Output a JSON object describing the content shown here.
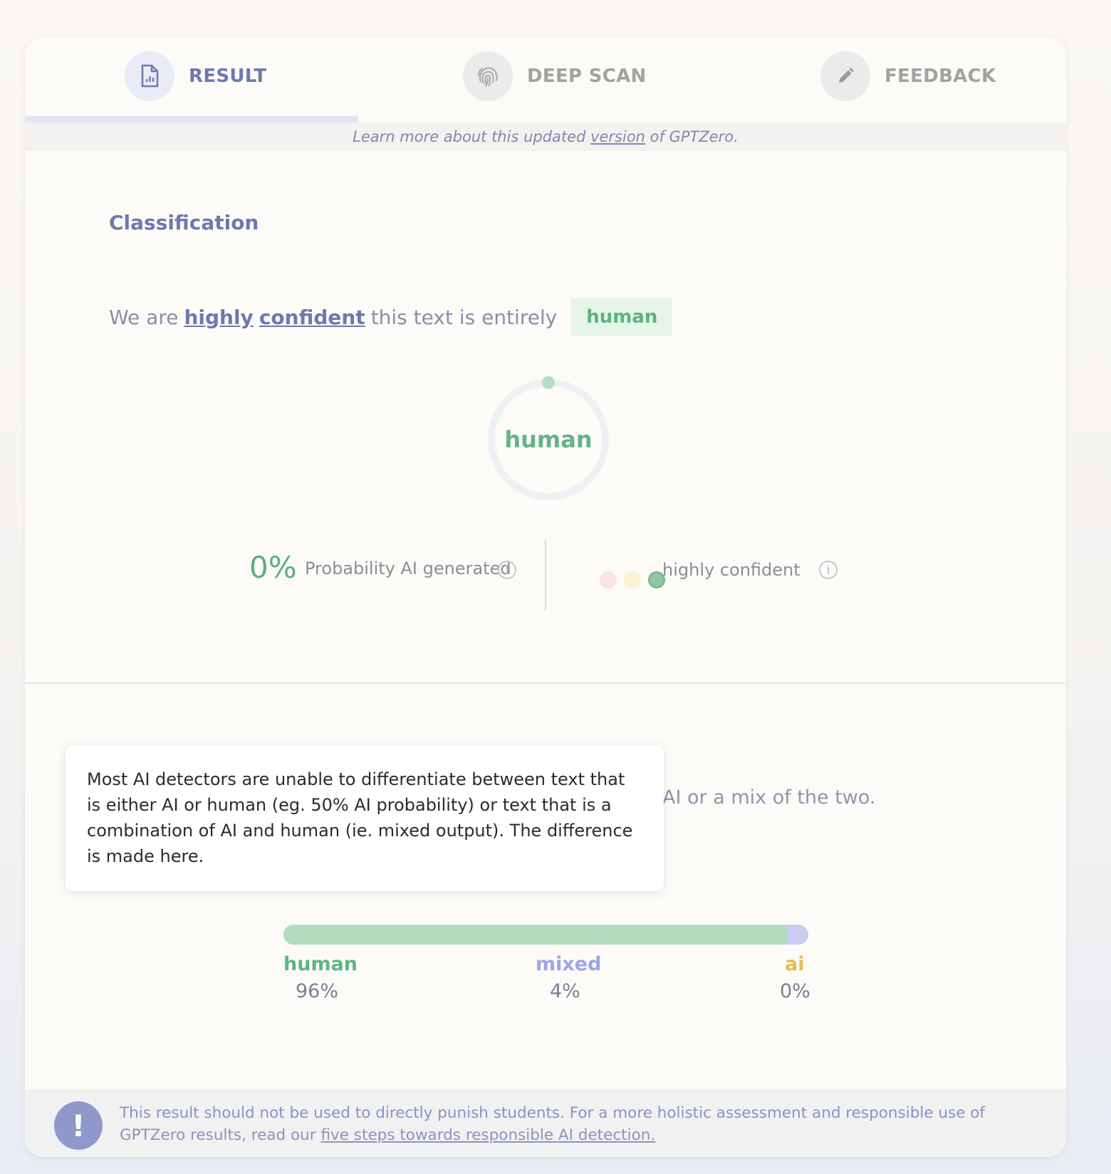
{
  "tabs": [
    {
      "label": "RESULT",
      "icon": "report-icon",
      "active": true
    },
    {
      "label": "DEEP SCAN",
      "icon": "fingerprint-icon",
      "active": false
    },
    {
      "label": "FEEDBACK",
      "icon": "pencil-icon",
      "active": false
    }
  ],
  "version_notice": {
    "before": "Learn more about this updated ",
    "link": "version",
    "after": " of GPTZero."
  },
  "classification": {
    "title": "Classification",
    "prefix": "We are ",
    "confidence_word1": "highly",
    "confidence_word2": "confident",
    "middle": " this text is entirely",
    "verdict": "human"
  },
  "gauge": {
    "label": "human",
    "ai_probability": 0,
    "track_color": "#eef0f4",
    "marker_color": "#b5dcc4"
  },
  "stats": {
    "ai_probability_text": "0%",
    "ai_probability_label": "Probability AI generated",
    "confidence_label": "highly confident",
    "confidence_dots": [
      "#fbe3e3",
      "#fbf3cf",
      "#8fc5a3"
    ]
  },
  "mix_text": "AI or a mix of the two.",
  "tooltip": "Most AI detectors are unable to differentiate between text that is either AI or human (eg. 50% AI probability) or text that is a combination of AI and human (ie. mixed output). The difference is made here.",
  "distribution": [
    {
      "name": "human",
      "value_text": "96%",
      "value": 96,
      "color": "#b2dcc0",
      "label_color": "#5cb584"
    },
    {
      "name": "mixed",
      "value_text": "4%",
      "value": 4,
      "color": "#c9cdf2",
      "label_color": "#9aa5ea"
    },
    {
      "name": "ai",
      "value_text": "0%",
      "value": 0,
      "color": "#f4c483",
      "label_color": "#edba4a"
    }
  ],
  "disclaimer": {
    "icon": "exclamation-icon",
    "text": "This result should not be used to directly punish students. For a more holistic assessment and responsible use of GPTZero results, read our ",
    "link": "five steps towards responsible AI detection."
  },
  "colors": {
    "accent": "#6d79b0",
    "human_green": "#5cb584"
  }
}
